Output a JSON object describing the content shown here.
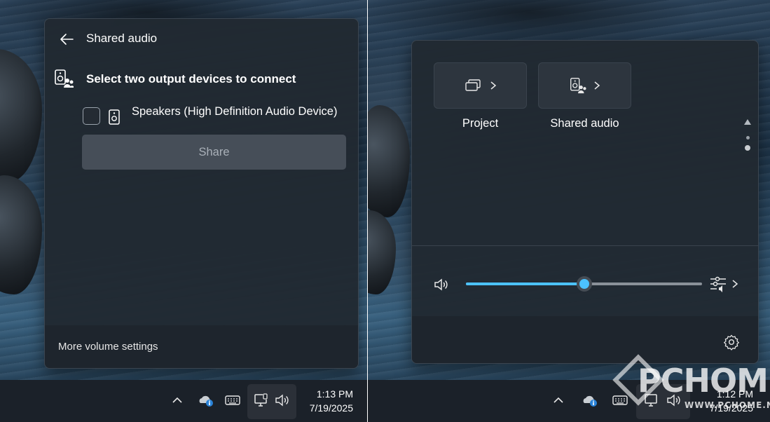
{
  "left_screen": {
    "panel": {
      "title": "Shared audio",
      "heading": "Select two output devices to connect",
      "devices": [
        {
          "label": "Speakers (High Definition Audio Device)",
          "checked": false
        }
      ],
      "share_button": "Share",
      "footer_link": "More volume settings"
    },
    "taskbar": {
      "time": "1:13 PM",
      "date": "7/19/2025",
      "icons": [
        "chevron-up-icon",
        "onedrive-icon",
        "keyboard-icon",
        "network-icon",
        "speaker-icon"
      ]
    }
  },
  "right_screen": {
    "quick_settings": {
      "tiles": [
        {
          "label": "Project",
          "icon": "project-icon"
        },
        {
          "label": "Shared audio",
          "icon": "shared-audio-icon"
        }
      ],
      "volume_percent": 50,
      "accent_color": "#4cc2ff",
      "icons": [
        "speaker-icon",
        "mixer-icon",
        "gear-icon"
      ]
    },
    "taskbar": {
      "time": "1:12 PM",
      "date": "7/19/2025",
      "icons": [
        "chevron-up-icon",
        "onedrive-icon",
        "keyboard-icon",
        "network-icon",
        "speaker-icon"
      ]
    }
  },
  "watermark": {
    "brand": "PCHOME",
    "site": "WWW.PCHOME.NET"
  }
}
